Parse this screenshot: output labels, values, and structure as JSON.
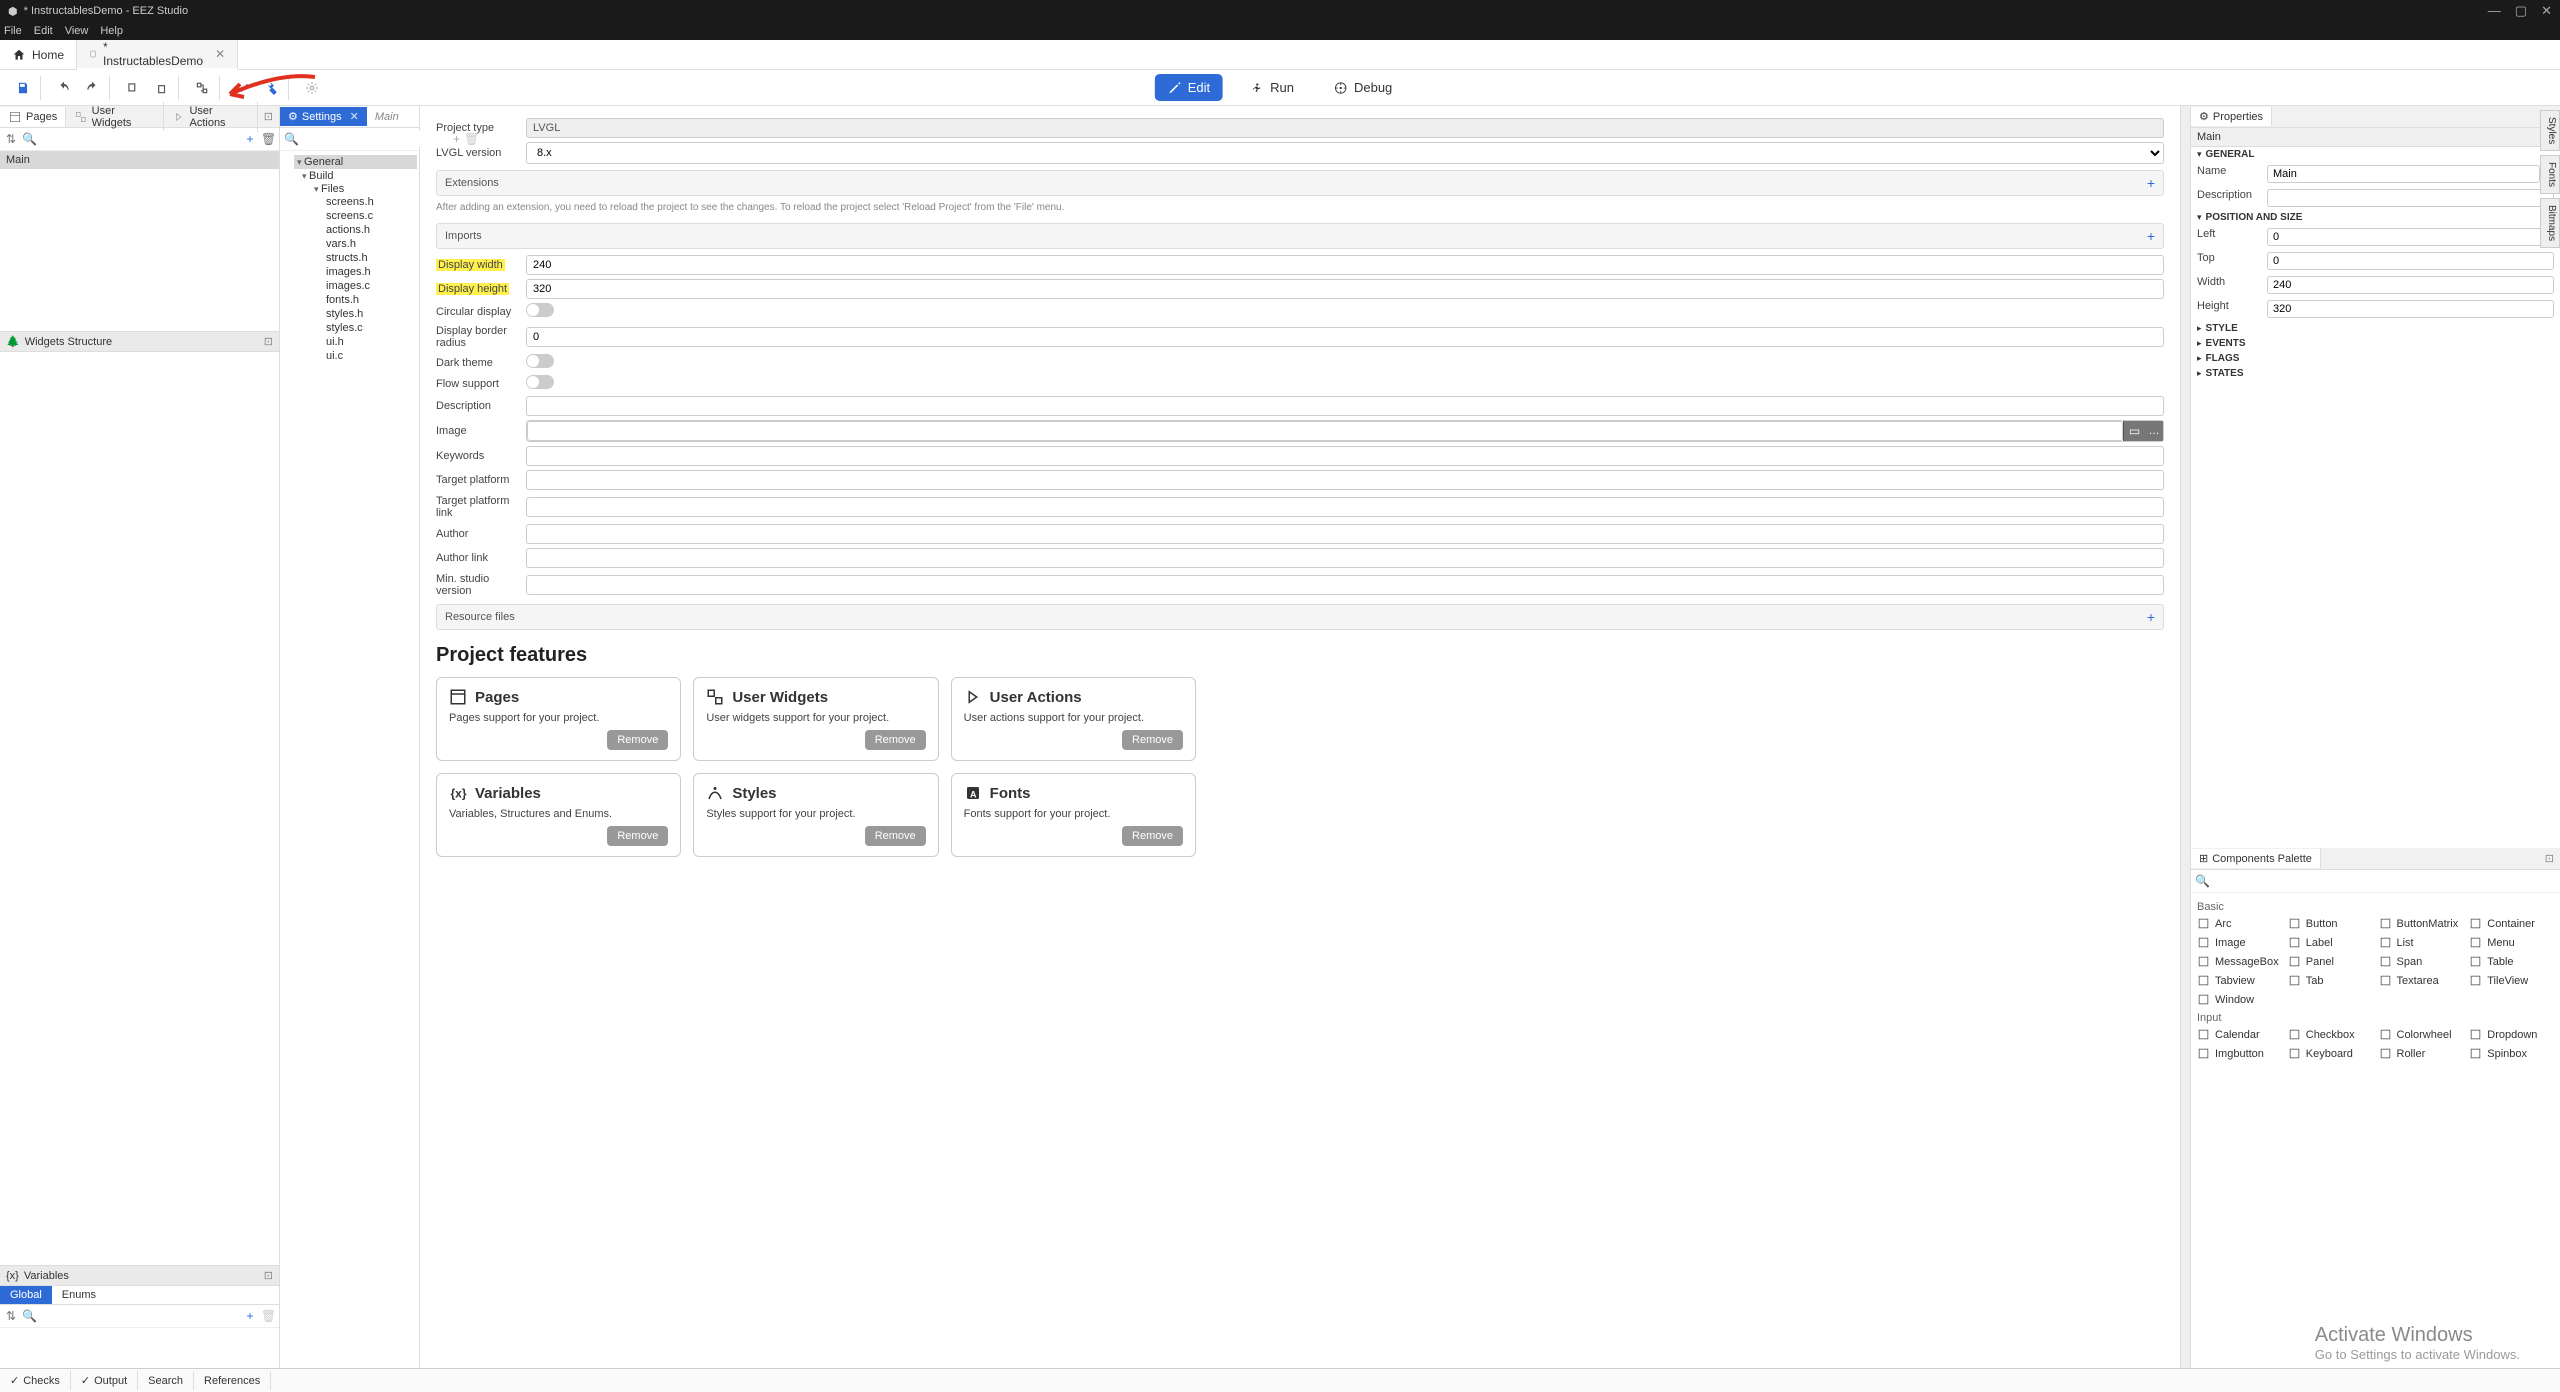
{
  "window": {
    "title": "* InstructablesDemo - EEZ Studio"
  },
  "menubar": [
    "File",
    "Edit",
    "View",
    "Help"
  ],
  "tabs": {
    "home": "Home",
    "doc": "* InstructablesDemo"
  },
  "centerActions": {
    "edit": "Edit",
    "run": "Run",
    "debug": "Debug"
  },
  "leftTabs": {
    "pages": "Pages",
    "userWidgets": "User Widgets",
    "userActions": "User Actions"
  },
  "pages": {
    "items": [
      "Main"
    ]
  },
  "widgetsStructure": {
    "title": "Widgets Structure"
  },
  "variablesPanel": {
    "title": "Variables",
    "tabs": [
      "Global",
      "Enums"
    ]
  },
  "treeTabs": {
    "settings": "Settings",
    "main": "Main"
  },
  "tree": {
    "root": "General",
    "build": "Build",
    "files": "Files",
    "fileList": [
      "screens.h",
      "screens.c",
      "actions.h",
      "vars.h",
      "structs.h",
      "images.h",
      "images.c",
      "fonts.h",
      "styles.h",
      "styles.c",
      "ui.h",
      "ui.c"
    ]
  },
  "settingsForm": {
    "projectTypeLabel": "Project type",
    "projectType": "LVGL",
    "lvglVersionLabel": "LVGL version",
    "lvglVersion": "8.x",
    "extensions": "Extensions",
    "extHint": "After adding an extension, you need to reload the project to see the changes. To reload the project select 'Reload Project' from the 'File' menu.",
    "imports": "Imports",
    "displayWidthLabel": "Display width",
    "displayWidth": "240",
    "displayHeightLabel": "Display height",
    "displayHeight": "320",
    "circularLabel": "Circular display",
    "borderRadiusLabel": "Display border radius",
    "borderRadius": "0",
    "darkThemeLabel": "Dark theme",
    "flowSupportLabel": "Flow support",
    "descriptionLabel": "Description",
    "imageLabel": "Image",
    "keywordsLabel": "Keywords",
    "targetPlatformLabel": "Target platform",
    "targetPlatformLinkLabel": "Target platform link",
    "authorLabel": "Author",
    "authorLinkLabel": "Author link",
    "minStudioLabel": "Min. studio version",
    "resourceFiles": "Resource files"
  },
  "features": {
    "title": "Project features",
    "cards": [
      {
        "title": "Pages",
        "desc": "Pages support for your project.",
        "remove": "Remove"
      },
      {
        "title": "User Widgets",
        "desc": "User widgets support for your project.",
        "remove": "Remove"
      },
      {
        "title": "User Actions",
        "desc": "User actions support for your project.",
        "remove": "Remove"
      },
      {
        "title": "Variables",
        "desc": "Variables, Structures and Enums.",
        "remove": "Remove"
      },
      {
        "title": "Styles",
        "desc": "Styles support for your project.",
        "remove": "Remove"
      },
      {
        "title": "Fonts",
        "desc": "Fonts support for your project.",
        "remove": "Remove"
      }
    ]
  },
  "propertiesPanel": {
    "title": "Properties",
    "page": "Main",
    "groups": {
      "general": "GENERAL",
      "nameLabel": "Name",
      "name": "Main",
      "descLabel": "Description",
      "posSize": "POSITION AND SIZE",
      "leftLabel": "Left",
      "left": "0",
      "topLabel": "Top",
      "top": "0",
      "widthLabel": "Width",
      "width": "240",
      "heightLabel": "Height",
      "height": "320",
      "style": "STYLE",
      "events": "EVENTS",
      "flags": "FLAGS",
      "states": "STATES"
    }
  },
  "palettePanel": {
    "title": "Components Palette",
    "basic": "Basic",
    "input": "Input",
    "basicItems": [
      "Arc",
      "Button",
      "ButtonMatrix",
      "Container",
      "Image",
      "Label",
      "List",
      "Menu",
      "MessageBox",
      "Panel",
      "Span",
      "Table",
      "Tabview",
      "Tab",
      "Textarea",
      "TileView",
      "Window"
    ],
    "inputItems": [
      "Calendar",
      "Checkbox",
      "Colorwheel",
      "Dropdown",
      "Imgbutton",
      "Keyboard",
      "Roller",
      "Spinbox"
    ]
  },
  "sideTabs": [
    "Styles",
    "Fonts",
    "Bitmaps"
  ],
  "statusbar": {
    "checks": "Checks",
    "output": "Output",
    "search": "Search",
    "references": "References"
  },
  "watermark": {
    "line1": "Activate Windows",
    "line2": "Go to Settings to activate Windows."
  }
}
